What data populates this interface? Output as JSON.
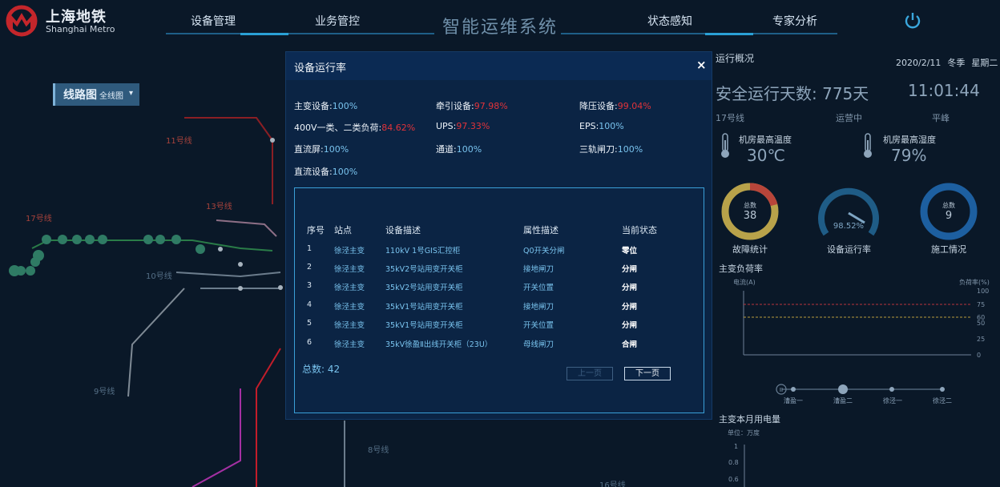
{
  "header": {
    "brand_cn": "上海地铁",
    "brand_en": "Shanghai Metro",
    "system_title": "智能运维系统",
    "nav": [
      "设备管理",
      "业务管控",
      "状态感知",
      "专家分析"
    ],
    "accent": "#c4262b"
  },
  "map": {
    "badge_title": "线路图",
    "badge_sub": "全线图",
    "line_labels": [
      "11号线",
      "13号线",
      "17号线",
      "10号线",
      "9号线",
      "8号线",
      "16号线"
    ]
  },
  "overview": {
    "title": "运行概况",
    "date": "2020/2/11",
    "season": "冬季",
    "weekday": "星期二",
    "safe_days": "安全运行天数: 775天",
    "clock": "11:01:44",
    "line": "17号线",
    "status": "运营中",
    "peak": "平峰",
    "temp_label": "机房最高温度",
    "temp_value": "30℃",
    "humidity_label": "机房最高湿度",
    "humidity_value": "79%",
    "gauges": [
      {
        "inner_label": "总数",
        "value": "38",
        "caption": "故障统计"
      },
      {
        "inner_label": "",
        "value": "98.52%",
        "caption": "设备运行率",
        "fraction": 0.9852
      },
      {
        "inner_label": "总数",
        "value": "9",
        "caption": "施工情况"
      }
    ],
    "load_title": "主变负荷率",
    "load_left_axis": "电流(A)",
    "load_right_axis": "负荷率(%)",
    "load_ticks": [
      "100",
      "75",
      "50",
      "25",
      "0"
    ],
    "load_marks": [
      "60"
    ],
    "timeline": [
      "漕盈一",
      "漕盈二",
      "徐泾一",
      "徐泾二"
    ],
    "energy_title": "主变本月用电量",
    "energy_unit": "单位：万度",
    "energy_ticks": [
      "1",
      "0.8",
      "0.6"
    ]
  },
  "modal": {
    "title": "设备运行率",
    "close": "×",
    "stats": [
      {
        "label": "主变设备:",
        "value": "100%",
        "bad": false
      },
      {
        "label": "牵引设备:",
        "value": "97.98%",
        "bad": true
      },
      {
        "label": "降压设备:",
        "value": "99.04%",
        "bad": true
      },
      {
        "label": "400V一类、二类负荷:",
        "value": "84.62%",
        "bad": true
      },
      {
        "label": "UPS:",
        "value": "97.33%",
        "bad": true
      },
      {
        "label": "EPS:",
        "value": "100%",
        "bad": false
      },
      {
        "label": "直流屏:",
        "value": "100%",
        "bad": false
      },
      {
        "label": "通道:",
        "value": "100%",
        "bad": false
      },
      {
        "label": "三轨闸刀:",
        "value": "100%",
        "bad": false
      },
      {
        "label": "直流设备:",
        "value": "100%",
        "bad": false
      }
    ],
    "columns": [
      "序号",
      "站点",
      "设备描述",
      "属性描述",
      "当前状态"
    ],
    "rows": [
      [
        "1",
        "徐泾主变",
        "110kV 1号GIS汇控柜",
        "Q0开关分闸",
        "零位"
      ],
      [
        "2",
        "徐泾主变",
        "35kV2号站用变开关柜",
        "接地闸刀",
        "分闸"
      ],
      [
        "3",
        "徐泾主变",
        "35kV2号站用变开关柜",
        "开关位置",
        "分闸"
      ],
      [
        "4",
        "徐泾主变",
        "35kV1号站用变开关柜",
        "接地闸刀",
        "分闸"
      ],
      [
        "5",
        "徐泾主变",
        "35kV1号站用变开关柜",
        "开关位置",
        "分闸"
      ],
      [
        "6",
        "徐泾主变",
        "35kV徐盈Ⅱ出线开关柜（23U）",
        "母线闸刀",
        "合闸"
      ]
    ],
    "total": "总数: 42",
    "prev": "上一页",
    "next": "下一页"
  }
}
